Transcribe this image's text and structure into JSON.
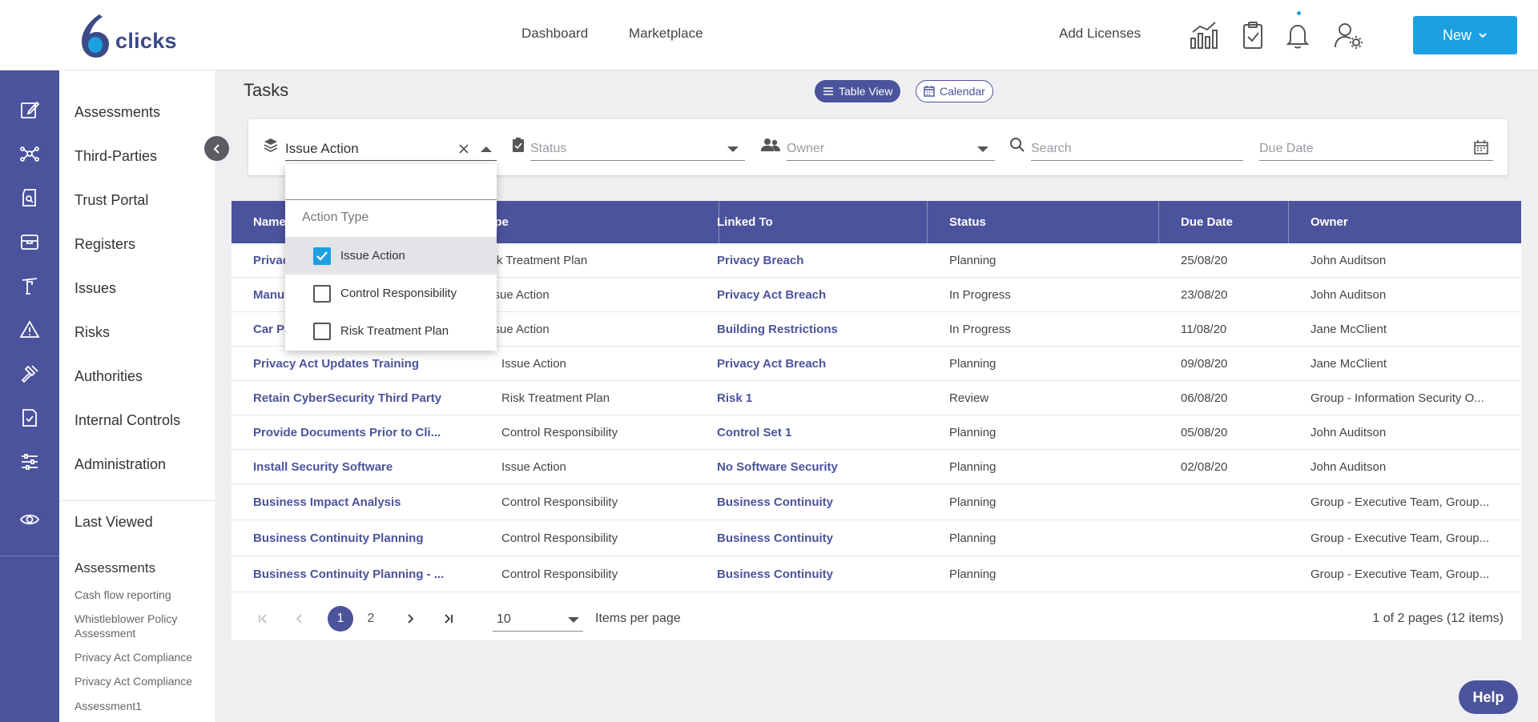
{
  "brand": {
    "name": "clicks",
    "colors": {
      "primary": "#4b539c",
      "accent": "#1ba1e2"
    }
  },
  "topnav": {
    "links": [
      "Dashboard",
      "Marketplace"
    ],
    "add_licenses": "Add Licenses",
    "new_button": "New",
    "icons": [
      "chart-icon",
      "clipboard-check-icon",
      "bell-icon",
      "user-settings-icon"
    ]
  },
  "rail_icons": [
    "edit-icon",
    "network-icon",
    "portal-icon",
    "register-icon",
    "issues-icon",
    "warning-icon",
    "gavel-icon",
    "document-check-icon",
    "sliders-icon",
    "eye-icon"
  ],
  "sidebar": {
    "items": [
      "Assessments",
      "Third-Parties",
      "Trust Portal",
      "Registers",
      "Issues",
      "Risks",
      "Authorities",
      "Internal Controls",
      "Administration"
    ],
    "last_viewed": "Last Viewed",
    "last_viewed_section": "Assessments",
    "recent": [
      "Cash flow reporting",
      "Whistleblower Policy Assessment",
      "Privacy Act Compliance",
      "Privacy Act Compliance",
      "Assessment1"
    ]
  },
  "page": {
    "title": "Tasks",
    "views": {
      "table": "Table View",
      "calendar": "Calendar"
    }
  },
  "filters": {
    "action_type_value": "Issue Action",
    "status_placeholder": "Status",
    "owner_placeholder": "Owner",
    "search_placeholder": "Search",
    "due_date_placeholder": "Due Date"
  },
  "dropdown": {
    "header": "Action Type",
    "options": [
      {
        "label": "Issue Action",
        "checked": true
      },
      {
        "label": "Control Responsibility",
        "checked": false
      },
      {
        "label": "Risk Treatment Plan",
        "checked": false
      }
    ]
  },
  "table": {
    "headers": [
      "Name",
      "Type",
      "Linked To",
      "Status",
      "Due Date",
      "Owner"
    ],
    "header_partial": [
      "Name",
      "ype"
    ],
    "rows": [
      {
        "name": "Privac",
        "type": "isk Treatment Plan",
        "linked": "Privacy Breach",
        "status": "Planning",
        "due": "25/08/20",
        "owner": "John Auditson"
      },
      {
        "name": "Manu",
        "type": "ssue Action",
        "linked": "Privacy Act Breach",
        "status": "In Progress",
        "due": "23/08/20",
        "owner": "John Auditson"
      },
      {
        "name": "Car Pa",
        "type": "ssue Action",
        "linked": "Building Restrictions",
        "status": "In Progress",
        "due": "11/08/20",
        "owner": "Jane McClient"
      },
      {
        "name": "Privacy Act Updates Training",
        "type": "Issue Action",
        "linked": "Privacy Act Breach",
        "status": "Planning",
        "due": "09/08/20",
        "owner": "Jane McClient"
      },
      {
        "name": "Retain CyberSecurity Third Party",
        "type": "Risk Treatment Plan",
        "linked": "Risk 1",
        "status": "Review",
        "due": "06/08/20",
        "owner": "Group - Information Security O..."
      },
      {
        "name": "Provide Documents Prior to Cli...",
        "type": "Control Responsibility",
        "linked": "Control Set 1",
        "status": "Planning",
        "due": "05/08/20",
        "owner": "John Auditson"
      },
      {
        "name": "Install Security Software",
        "type": "Issue Action",
        "linked": "No Software Security",
        "status": "Planning",
        "due": "02/08/20",
        "owner": "John Auditson"
      },
      {
        "name": "Business Impact Analysis",
        "type": "Control Responsibility",
        "linked": "Business Continuity",
        "status": "Planning",
        "due": "",
        "owner": "Group - Executive Team, Group..."
      },
      {
        "name": "Business Continuity Planning",
        "type": "Control Responsibility",
        "linked": "Business Continuity",
        "status": "Planning",
        "due": "",
        "owner": "Group - Executive Team, Group..."
      },
      {
        "name": "Business Continuity Planning - ...",
        "type": "Control Responsibility",
        "linked": "Business Continuity",
        "status": "Planning",
        "due": "",
        "owner": "Group - Executive Team, Group..."
      }
    ]
  },
  "pagination": {
    "pages": [
      "1",
      "2"
    ],
    "current": "1",
    "items_per_page": "10",
    "items_per_page_label": "Items per page",
    "info": "1 of 2 pages (12 items)"
  },
  "help": "Help"
}
